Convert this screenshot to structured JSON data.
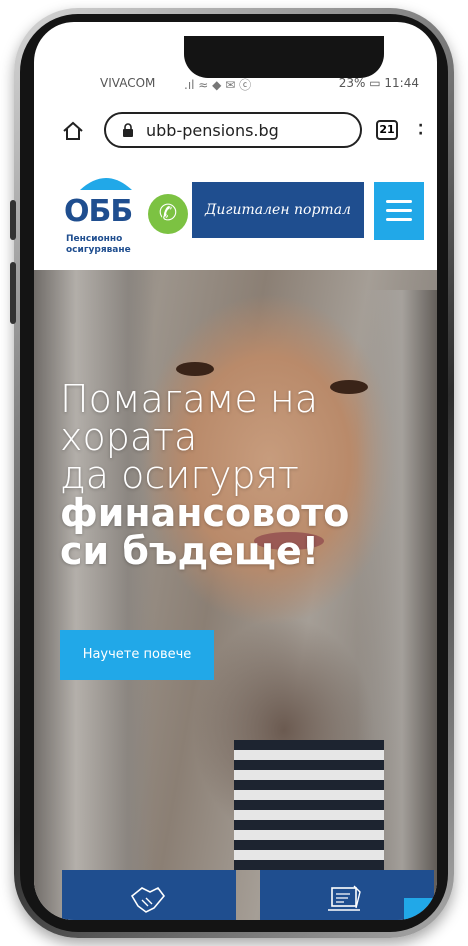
{
  "status_bar": {
    "carrier": "VIVACOM",
    "signal_icons": ".ıl ≈ ◆ ✉ ⓒ",
    "battery_text": "23%",
    "time": "11:44"
  },
  "browser": {
    "url": "ubb-pensions.bg",
    "tab_count": "21",
    "icons": [
      "home-icon",
      "lock-icon",
      "tabs-icon",
      "menu-kebab-icon"
    ]
  },
  "header": {
    "logo_text": "ОББ",
    "logo_subtitle_line1": "Пенсионно",
    "logo_subtitle_line2": "осигуряване",
    "portal_button": "Дигитален портал",
    "colors": {
      "brand_blue": "#1f4e8f",
      "accent_blue": "#21a8e8",
      "green": "#7cc242"
    }
  },
  "hero": {
    "title_lines": [
      "Помагаме на",
      "хората",
      "да осигурят"
    ],
    "title_bold_lines": [
      "финансовото",
      "си бъдеще!"
    ],
    "cta_label": "Научете повече"
  },
  "cards": {
    "icons": [
      "handshake-icon",
      "laptop-document-icon"
    ]
  },
  "scroll_top": {
    "icon": "chevron-up-icon"
  }
}
